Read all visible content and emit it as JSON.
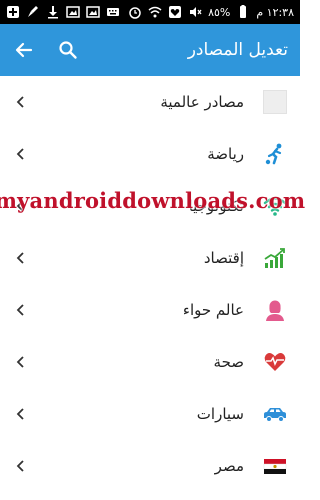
{
  "status_bar": {
    "time": "١٢:٣٨ م",
    "battery": "٨٥%",
    "left_icons": [
      "add-icon",
      "broom-icon",
      "download-icon",
      "image-icon",
      "image-icon",
      "keyboard-icon"
    ],
    "right_icons": [
      "alarm-icon",
      "wifi-icon",
      "heart-icon",
      "mute-icon",
      "signal-icon",
      "battery-icon"
    ]
  },
  "app_bar": {
    "title": "تعديل المصادر",
    "color": "#2f96db"
  },
  "items": [
    {
      "label": "مصادر عالمية",
      "icon": "world-sources-icon"
    },
    {
      "label": "رياضة",
      "icon": "soccer-icon"
    },
    {
      "label": "تكنولوجيا",
      "icon": "wifi-icon"
    },
    {
      "label": "إقتصاد",
      "icon": "economy-chart-icon"
    },
    {
      "label": "عالم حواء",
      "icon": "woman-icon"
    },
    {
      "label": "صحة",
      "icon": "heart-pulse-icon"
    },
    {
      "label": "سيارات",
      "icon": "car-icon"
    },
    {
      "label": "مصر",
      "icon": "egypt-flag-icon"
    }
  ],
  "watermark": "myandroiddownloads.com"
}
